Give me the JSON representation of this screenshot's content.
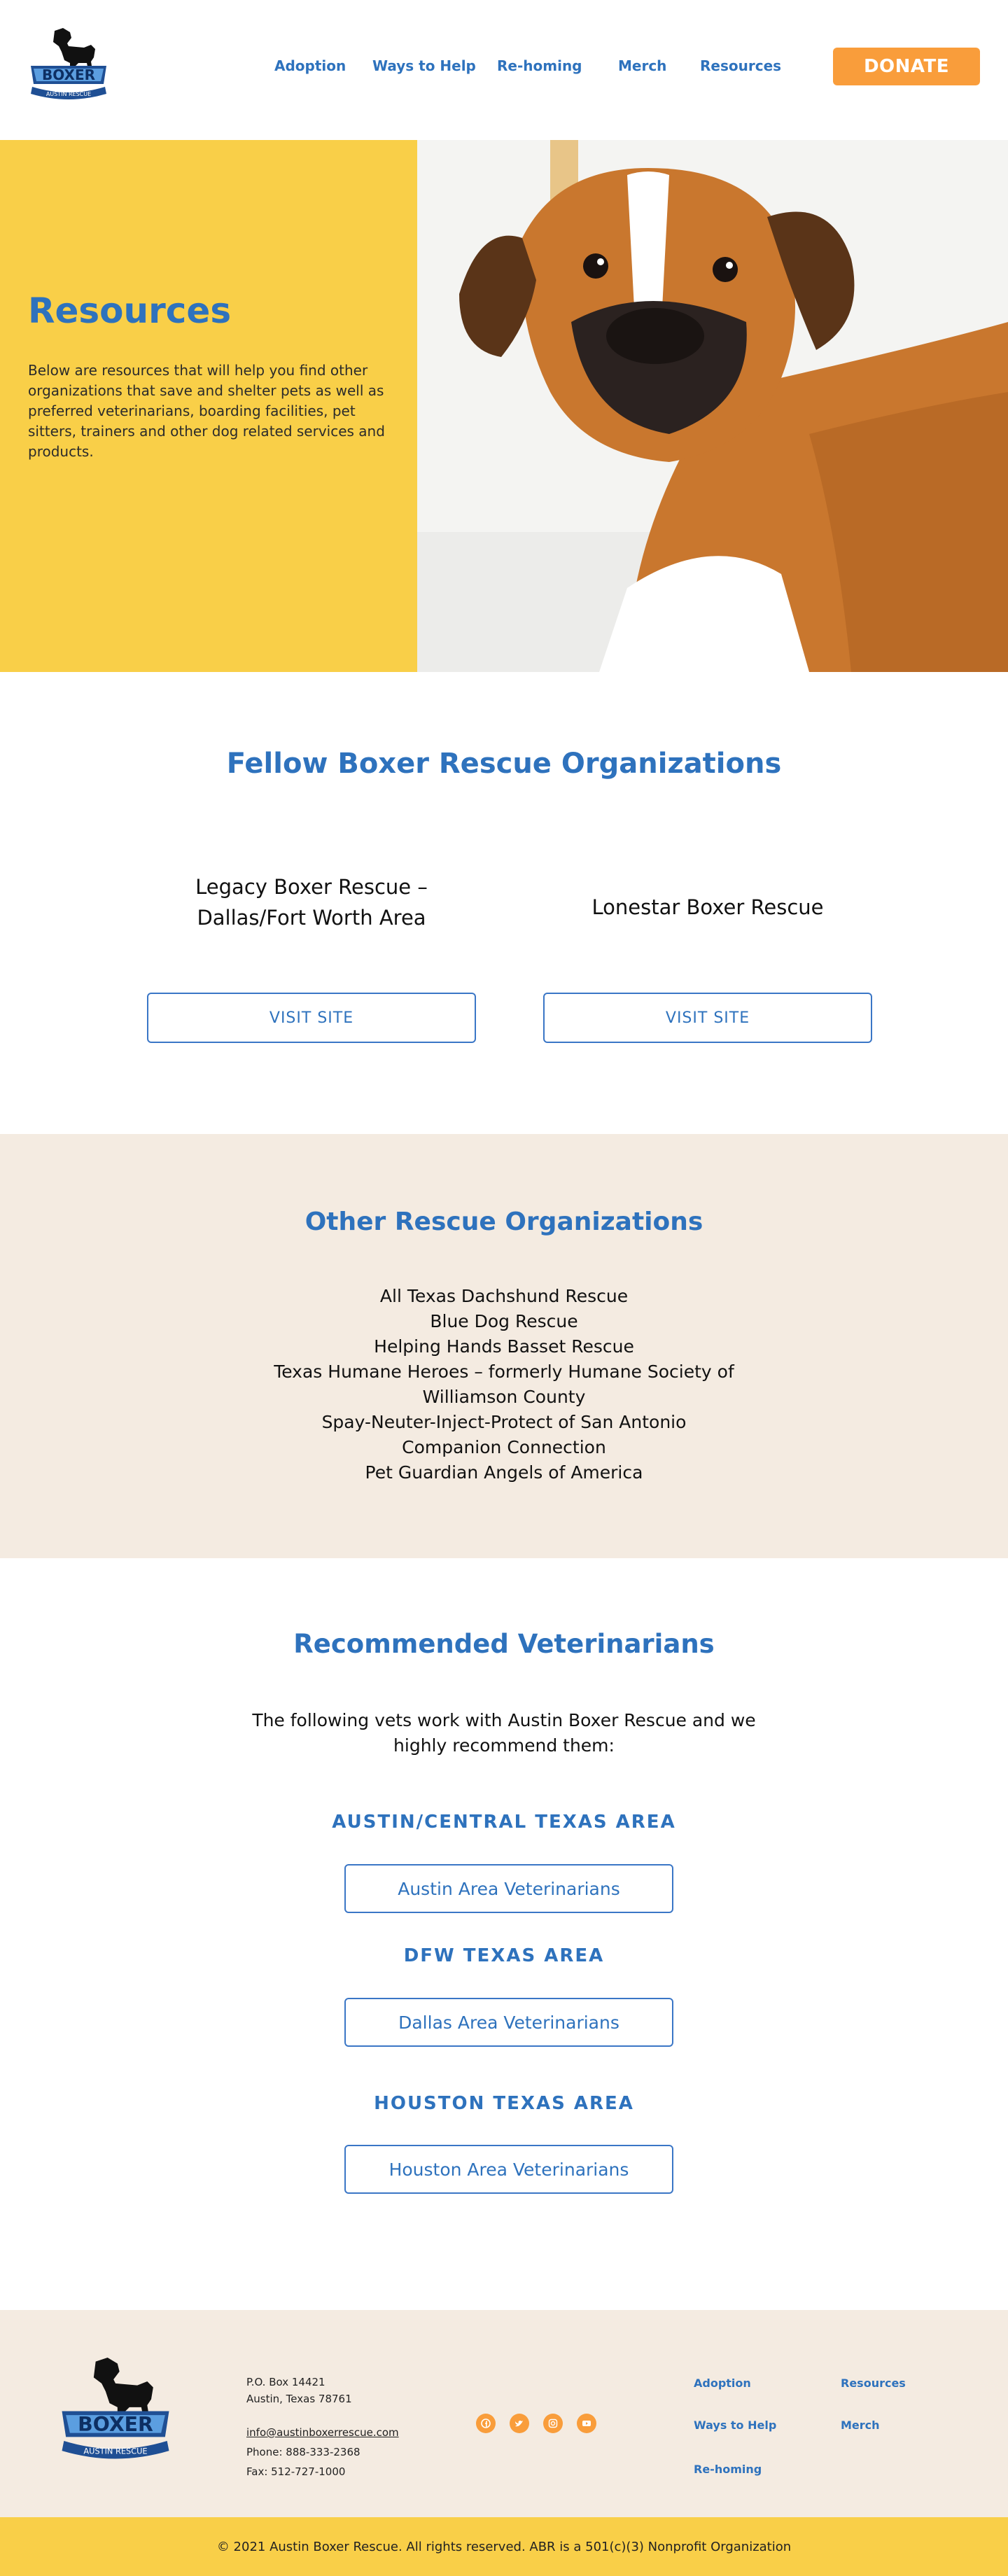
{
  "brand": {
    "logo_text": "BOXER",
    "logo_subtext": "AUSTIN RESCUE"
  },
  "nav": {
    "items": [
      "Adoption",
      "Ways to Help",
      "Re-homing",
      "Merch",
      "Resources"
    ],
    "donate_label": "DONATE"
  },
  "hero": {
    "title": "Resources",
    "text": "Below are resources that will help you find other organizations that save and shelter pets as well as preferred veterinarians, boarding facilities, pet sitters, trainers and other dog related services and products."
  },
  "fellow": {
    "title": "Fellow Boxer Rescue Organizations",
    "orgs": [
      {
        "name": "Legacy Boxer Rescue – Dallas/Fort Worth Area",
        "button": "VISIT SITE"
      },
      {
        "name": "Lonestar Boxer Rescue",
        "button": "VISIT SITE"
      }
    ]
  },
  "other": {
    "title": "Other Rescue Organizations",
    "items": [
      "All Texas Dachshund Rescue",
      "Blue Dog Rescue",
      "Helping Hands Basset Rescue",
      "Texas Humane Heroes – formerly Humane Society of Williamson County",
      "Spay-Neuter-Inject-Protect of San Antonio",
      "Companion Connection",
      "Pet Guardian Angels of America"
    ]
  },
  "vets": {
    "title": "Recommended Veterinarians",
    "intro": "The following vets work with Austin Boxer Rescue and we highly recommend them:",
    "areas": [
      {
        "heading": "AUSTIN/CENTRAL TEXAS AREA",
        "button": "Austin Area Veterinarians"
      },
      {
        "heading": "DFW TEXAS AREA",
        "button": "Dallas Area Veterinarians"
      },
      {
        "heading": "HOUSTON TEXAS AREA",
        "button": "Houston Area Veterinarians"
      }
    ]
  },
  "footer": {
    "address1": "P.O. Box 14421",
    "address2": "Austin, Texas 78761",
    "email": "info@austinboxerrescue.com",
    "phone": "Phone: 888-333-2368",
    "fax": "Fax: 512-727-1000",
    "socials": [
      "facebook-icon",
      "twitter-icon",
      "instagram-icon",
      "youtube-icon"
    ],
    "links": [
      "Adoption",
      "Resources",
      "Ways to Help",
      "Merch",
      "Re-homing"
    ],
    "copyright": "© 2021 Austin Boxer Rescue. All rights reserved. ABR is a 501(c)(3) Nonprofit Organization"
  },
  "colors": {
    "brand_blue": "#2e72bd",
    "yellow": "#f9cf48",
    "orange": "#f99d3b",
    "beige": "#f4ebe1"
  }
}
